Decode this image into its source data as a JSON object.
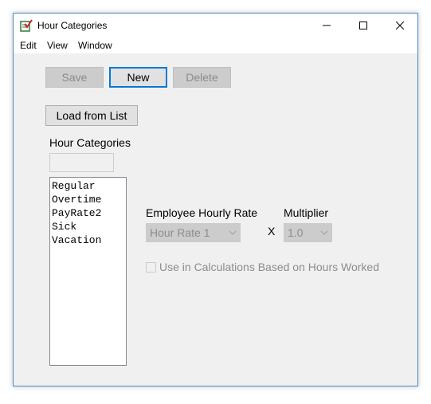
{
  "window": {
    "title": "Hour Categories"
  },
  "menu": {
    "items": [
      "Edit",
      "View",
      "Window"
    ]
  },
  "toolbar": {
    "save_label": "Save",
    "new_label": "New",
    "delete_label": "Delete",
    "load_label": "Load from List"
  },
  "categories": {
    "heading": "Hour Categories",
    "name_value": "",
    "items": [
      "Regular",
      "Overtime",
      "PayRate2",
      "Sick",
      "Vacation"
    ]
  },
  "rate": {
    "label": "Employee Hourly Rate",
    "selected": "Hour Rate 1",
    "times": "X"
  },
  "multiplier": {
    "label": "Multiplier",
    "selected": "1.0"
  },
  "calc": {
    "checkbox_label": "Use in Calculations Based on Hours Worked",
    "checked": false
  },
  "colors": {
    "window_border": "#4a8cc9",
    "focus_border": "#0078d7",
    "disabled_text": "#8c8c8c"
  }
}
